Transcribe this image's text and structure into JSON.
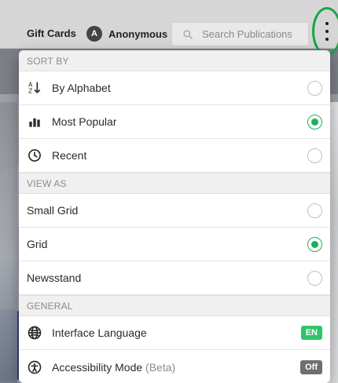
{
  "header": {
    "gift_cards_label": "Gift Cards",
    "user": {
      "avatar_letter": "A",
      "name": "Anonymous"
    },
    "search": {
      "placeholder": "Search Publications"
    },
    "menu_icon_name": "kebab-vertical-icon"
  },
  "menu": {
    "sections": {
      "sort_by": "SORT BY",
      "view_as": "VIEW AS",
      "general": "GENERAL"
    },
    "sort": {
      "alphabet": "By Alphabet",
      "popular": "Most Popular",
      "recent": "Recent",
      "selected": "popular"
    },
    "view": {
      "small_grid": "Small Grid",
      "grid": "Grid",
      "newsstand": "Newsstand",
      "selected": "grid"
    },
    "general": {
      "language": {
        "label": "Interface Language",
        "value": "EN"
      },
      "accessibility": {
        "label": "Accessibility Mode",
        "suffix": "(Beta)",
        "value": "Off"
      }
    },
    "colors": {
      "accent_green": "#19b05a",
      "badge_green": "#2fc46a",
      "badge_gray": "#6f6f6f",
      "highlight_ring": "#19a24a"
    }
  }
}
